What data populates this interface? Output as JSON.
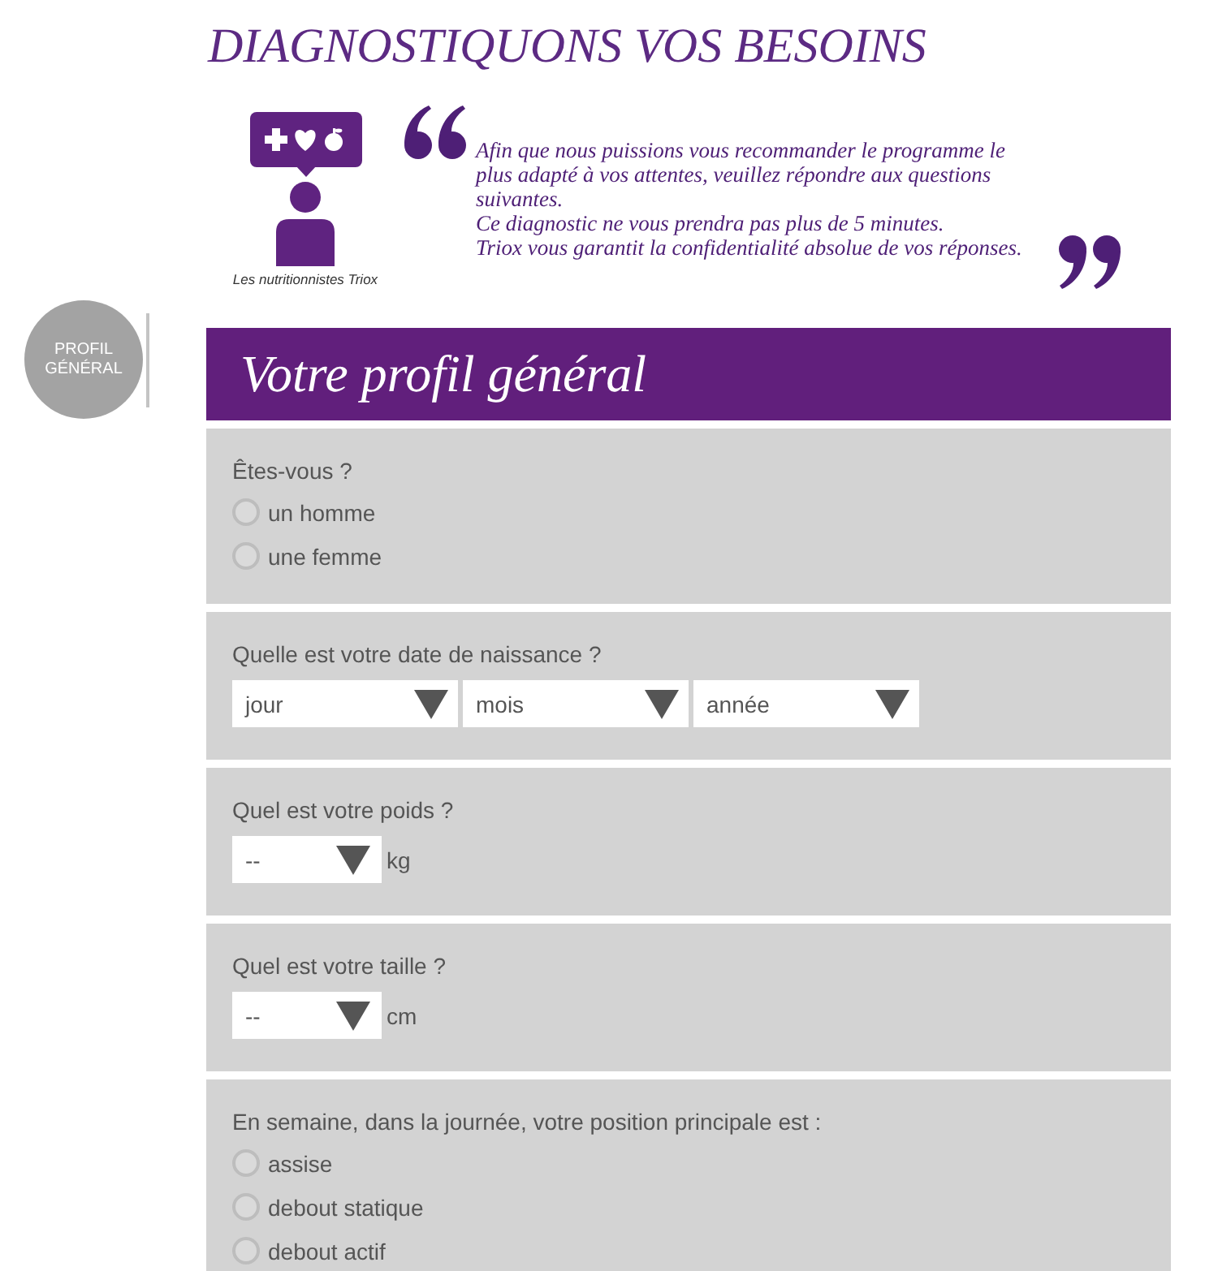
{
  "title": "DIAGNOSTIQUONS VOS BESOINS",
  "intro": {
    "caption": "Les nutritionnistes Triox",
    "paragraphs": [
      "Afin que nous puissions vous recommander le programme le plus adapté à vos attentes, veuillez répondre aux questions suivantes.",
      "Ce diagnostic ne vous prendra pas plus de 5 minutes.",
      "Triox vous garantit la confidentialité absolue de vos réponses."
    ]
  },
  "steps": [
    {
      "label": "PROFIL GÉNÉRAL"
    }
  ],
  "section_header": "Votre profil général",
  "questions": [
    {
      "kind": "radio",
      "label": "Êtes-vous ?",
      "options": [
        {
          "label": "un homme",
          "selected": false
        },
        {
          "label": "une femme",
          "selected": false
        }
      ]
    },
    {
      "kind": "date",
      "label": "Quelle est votre date de naissance ?",
      "dropdowns": [
        {
          "value": "jour"
        },
        {
          "value": "mois"
        },
        {
          "value": "année"
        }
      ]
    },
    {
      "kind": "measure",
      "label": "Quel est votre poids ?",
      "dropdown": {
        "value": "--"
      },
      "unit": "kg"
    },
    {
      "kind": "measure",
      "label": "Quel est votre taille ?",
      "dropdown": {
        "value": "--"
      },
      "unit": "cm"
    },
    {
      "kind": "radio",
      "label": "En semaine, dans la journée, votre position principale est :",
      "options": [
        {
          "label": "assise",
          "selected": false
        },
        {
          "label": "debout statique",
          "selected": false
        },
        {
          "label": "debout actif",
          "selected": false
        }
      ]
    }
  ]
}
